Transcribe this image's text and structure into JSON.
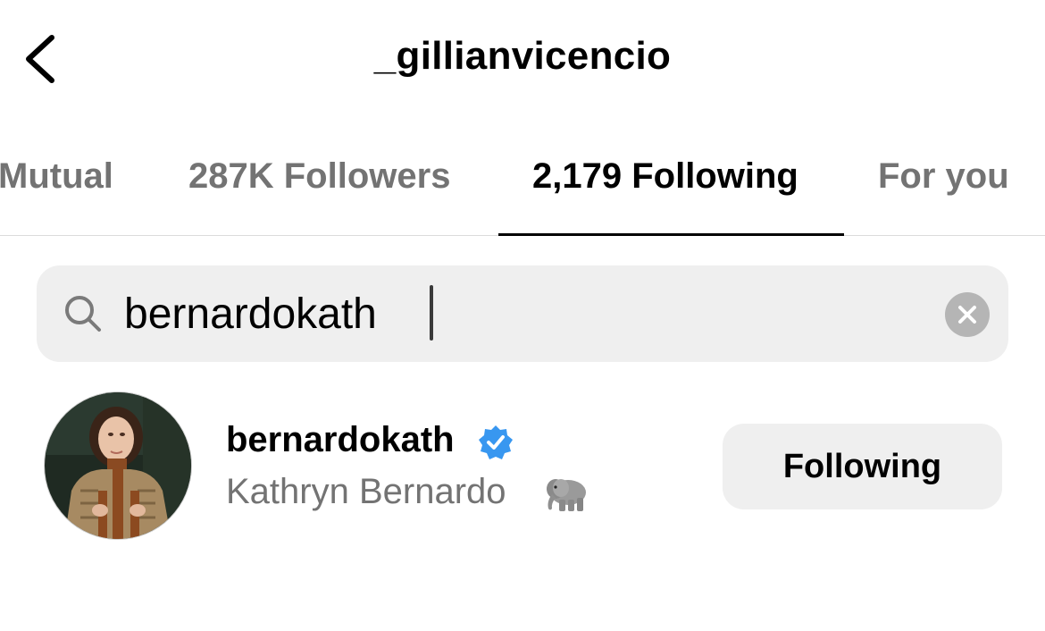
{
  "header": {
    "title": "_gillianvicencio",
    "back_icon": "chevron-left-icon"
  },
  "tabs": [
    {
      "label": "Mutual",
      "active": false
    },
    {
      "label": "287K Followers",
      "active": false
    },
    {
      "label": "2,179 Following",
      "active": true
    },
    {
      "label": "For you",
      "active": false
    }
  ],
  "search": {
    "value": "bernardokath",
    "search_icon": "search-icon",
    "clear_icon": "clear-icon"
  },
  "results": [
    {
      "username": "bernardokath",
      "verified": true,
      "full_name": "Kathryn Bernardo",
      "emoji": "elephant",
      "button_label": "Following"
    }
  ],
  "colors": {
    "verified_blue": "#3897f0",
    "secondary_text": "#737373",
    "field_bg": "#efefef"
  }
}
